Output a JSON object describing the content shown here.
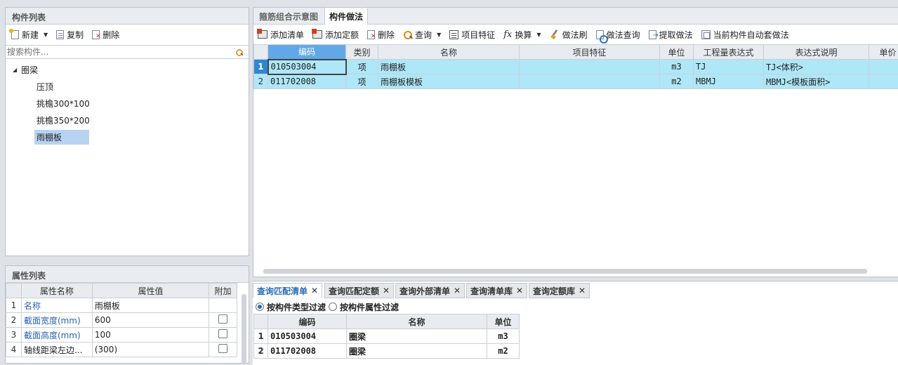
{
  "left_panel": {
    "title": "构件列表",
    "toolbar": {
      "new": "新建",
      "copy": "复制",
      "delete": "删除"
    },
    "search_placeholder": "搜索构件...",
    "tree": {
      "root": "圈梁",
      "children": [
        "压顶",
        "挑檐300*100",
        "挑檐350*200",
        "雨棚板"
      ],
      "selected_index": 3
    }
  },
  "props_panel": {
    "title": "属性列表",
    "columns": [
      "属性名称",
      "属性值",
      "附加"
    ],
    "rows": [
      {
        "num": "1",
        "name": "名称",
        "value": "雨棚板",
        "has_check": false
      },
      {
        "num": "2",
        "name": "截面宽度(mm)",
        "value": "600",
        "has_check": true
      },
      {
        "num": "3",
        "name": "截面高度(mm)",
        "value": "100",
        "has_check": true
      },
      {
        "num": "4",
        "name": "轴线距梁左边...",
        "value": "(300)",
        "has_check": true
      }
    ]
  },
  "right_panel": {
    "tabs": [
      "箍筋组合示意图",
      "构件做法"
    ],
    "active_tab": 1,
    "toolbar": {
      "add_list": "添加清单",
      "add_quota": "添加定额",
      "delete": "删除",
      "query": "查询",
      "item_feature": "项目特征",
      "convert": "换算",
      "method_brush": "做法刷",
      "method_query": "做法查询",
      "extract_method": "提取做法",
      "auto_apply": "当前构件自动套做法"
    },
    "grid": {
      "columns": [
        "编码",
        "类别",
        "名称",
        "项目特征",
        "单位",
        "工程量表达式",
        "表达式说明",
        "单价"
      ],
      "rows": [
        {
          "num": "1",
          "code": "010503004",
          "type": "项",
          "name": "雨棚板",
          "feature": "",
          "unit": "m3",
          "expr": "TJ",
          "expr_desc": "TJ<体积>"
        },
        {
          "num": "2",
          "code": "011702008",
          "type": "项",
          "name": "雨棚板模板",
          "feature": "",
          "unit": "m2",
          "expr": "MBMJ",
          "expr_desc": "MBMJ<模板面积>"
        }
      ]
    }
  },
  "bottom_panel": {
    "tabs": [
      "查询匹配清单",
      "查询匹配定额",
      "查询外部清单",
      "查询清单库",
      "查询定额库"
    ],
    "active_tab": 0,
    "filters": [
      "按构件类型过滤",
      "按构件属性过滤"
    ],
    "active_filter": 0,
    "columns": [
      "编码",
      "名称",
      "单位"
    ],
    "rows": [
      {
        "num": "1",
        "code": "010503004",
        "name": "圈梁",
        "unit": "m3"
      },
      {
        "num": "2",
        "code": "011702008",
        "name": "圈梁",
        "unit": "m2"
      }
    ]
  }
}
